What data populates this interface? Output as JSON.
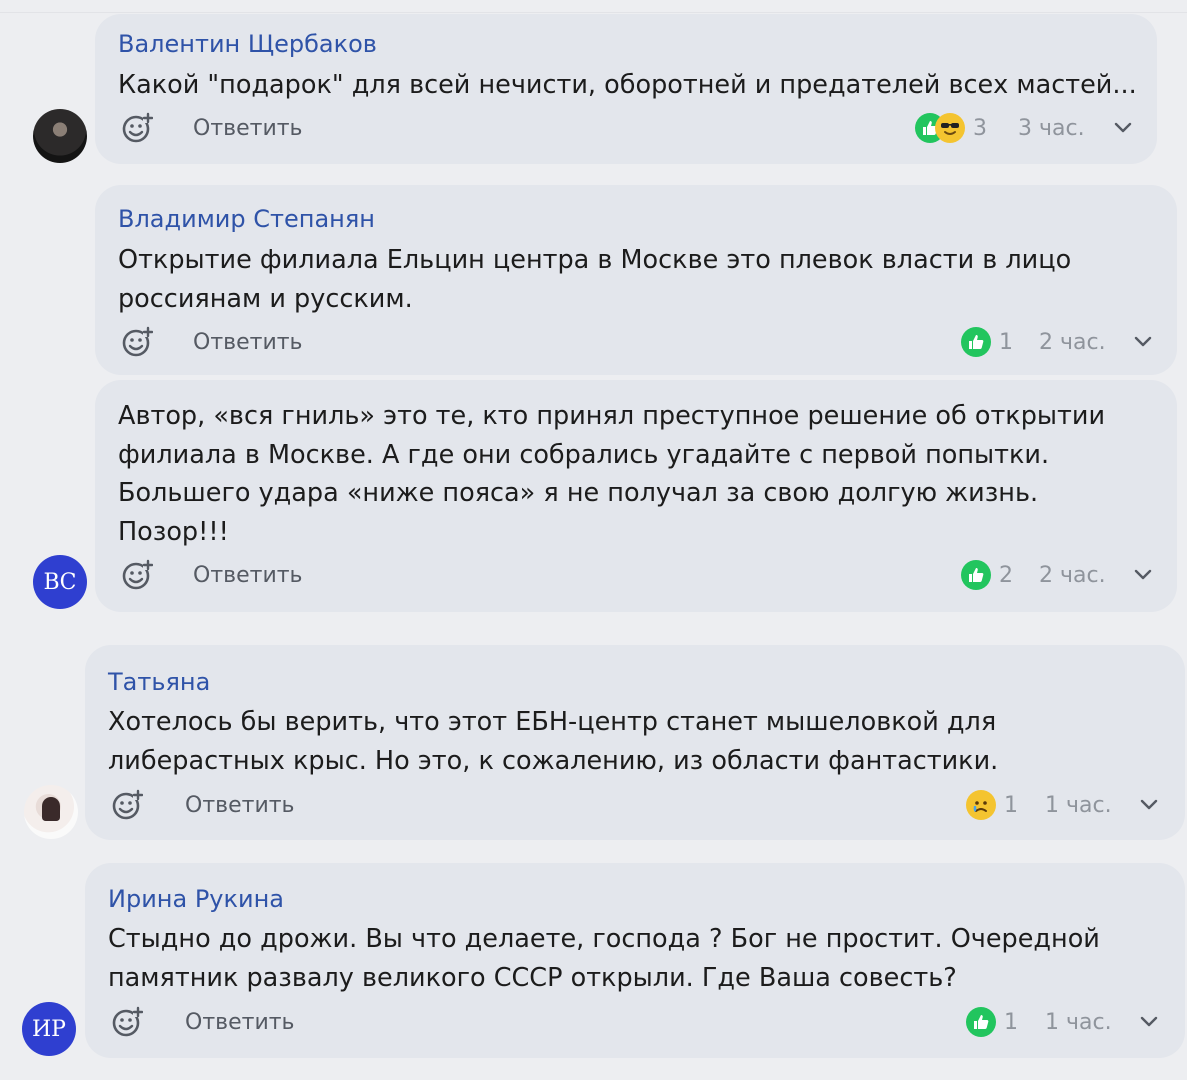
{
  "comments": [
    {
      "author": "Валентин Щербаков",
      "text": "Какой \"подарок\" для всей нечисти, оборотней и предателей всех мастей...",
      "reply_label": "Ответить",
      "reaction_icons": [
        "like-icon",
        "cool-face-icon"
      ],
      "reaction_count": "3",
      "time": "3 час.",
      "avatar_type": "photo"
    },
    {
      "author": "Владимир Степанян",
      "text": "Открытие филиала Ельцин центра в Москве это плевок власти в лицо россиянам и русским.",
      "reply_label": "Ответить",
      "reaction_icons": [
        "like-icon"
      ],
      "reaction_count": "1",
      "time": "2 час."
    },
    {
      "text": "Автор, «вся гниль» это те, кто принял преступное решение об открытии филиала в Москве. А где они собрались угадайте с первой попытки. Большего удара «ниже пояса» я не получал за свою долгую жизнь. Позор!!!",
      "reply_label": "Ответить",
      "reaction_icons": [
        "like-icon"
      ],
      "reaction_count": "2",
      "time": "2 час.",
      "avatar_initials": "ВС"
    },
    {
      "author": "Татьяна",
      "text": "Хотелось бы верить, что этот ЕБН-центр станет мышеловкой для либерастных крыс. Но это, к сожалению, из области фантастики.",
      "reply_label": "Ответить",
      "reaction_icons": [
        "sad-face-icon"
      ],
      "reaction_count": "1",
      "time": "1 час.",
      "avatar_type": "photo"
    },
    {
      "author": "Ирина Рукина",
      "text": "Стыдно до дрожи. Вы что делаете, господа ? Бог не простит. Очередной памятник развалу великого СССР открыли. Где Ваша совесть?",
      "reply_label": "Ответить",
      "reaction_icons": [
        "like-icon"
      ],
      "reaction_count": "1",
      "time": "1 час.",
      "avatar_initials": "ИР"
    }
  ],
  "colors": {
    "author": "#2f53a8",
    "card": "#e3e6ec",
    "background": "#edeef1",
    "like": "#22c55e",
    "emoji": "#f4c430",
    "avatar_initials_bg": "#2f3fd0"
  }
}
